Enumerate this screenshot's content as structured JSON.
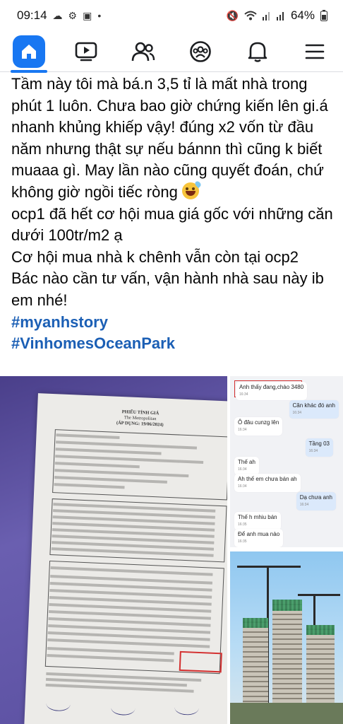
{
  "status_bar": {
    "time": "09:14",
    "battery": "64%"
  },
  "nav": {
    "items": [
      "home-icon",
      "video-icon",
      "friends-icon",
      "groups-icon",
      "notifications-icon",
      "menu-icon"
    ],
    "accent": "#1877f2"
  },
  "post": {
    "paragraph_1": "Tầm này tôi mà bá.n 3,5 tỉ là mất nhà trong phút 1 luôn. Chưa bao giờ chứng kiến lên gi.á nhanh khủng khiếp vậy! đúng x2 vốn từ đầu năm nhưng thật sự nếu bánnn thì cũng k biết muaaa gì. May lần nào cũng quyết đoán, chứ không giờ ngồi tiếc ròng",
    "paragraph_2": "ocp1 đã hết cơ hội mua giá gốc với những căn dưới 100tr/m2 ạ",
    "paragraph_3": "Cơ hội mua nhà k chênh vẫn còn tại ocp2",
    "paragraph_4": "Bác nào cần tư vấn, vận hành nhà sau này ib em nhé!",
    "hashtag_1": "#myanhstory",
    "hashtag_2": "#VinhomesOceanPark",
    "hashtag_color": "#1b5fb5"
  },
  "photos": {
    "document": {
      "title_1": "PHIẾU TÍNH GIÁ",
      "title_2": "The Metropolitan",
      "title_3": "(ÁP DỤNG: 19/06/2024)"
    },
    "chat": {
      "messages": [
        {
          "text": "Anh thấy đang,chào 3480",
          "time": "16:34",
          "me": false
        },
        {
          "text": "Căn khác đó anh",
          "time": "16:34",
          "me": true
        },
        {
          "text": "Ô đâu cunzg lên",
          "time": "16:34",
          "me": false
        },
        {
          "text": "Tầng 03",
          "time": "16:34",
          "me": true
        },
        {
          "text": "Thế ah",
          "time": "16:34",
          "me": false
        },
        {
          "text": "Ah thế em chưa bán ah",
          "time": "16:34",
          "me": false
        },
        {
          "text": "Dạ chưa anh",
          "time": "16:34",
          "me": true
        },
        {
          "text": "Thế h mhiu bán",
          "time": "16:35",
          "me": false
        },
        {
          "text": "Để anh mua nào",
          "time": "16:35",
          "me": false
        }
      ]
    }
  }
}
